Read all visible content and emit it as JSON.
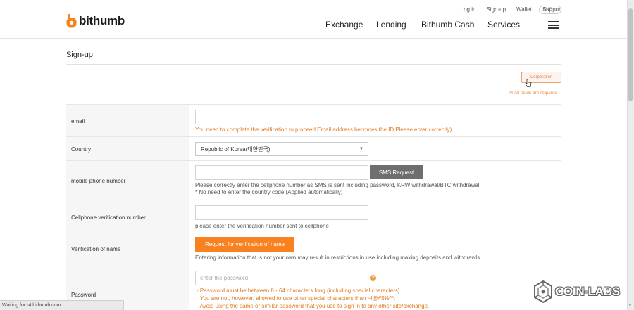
{
  "header": {
    "top_links": [
      "Log in",
      "Sign-up",
      "Wallet",
      "Support"
    ],
    "language": "ENG",
    "logo_text": "bithumb",
    "nav": [
      "Exchange",
      "Lending",
      "Bithumb Cash",
      "Services"
    ]
  },
  "page": {
    "title": "Sign-up",
    "corporation_button": "Corporation",
    "required_note": "※ All fields are required"
  },
  "form": {
    "email": {
      "label": "email",
      "message": "You need to complete the verification to proceed Email address becomes the ID Please enter correctly)"
    },
    "country": {
      "label": "Country",
      "selected": "Republic of Korea(대한민국)"
    },
    "mobile": {
      "label": "mobile phone number",
      "button": "SMS Request",
      "help1": "Please correctly enter the cellphone number as SMS is sent including password, KRW withdrawal/BTC withdrawal",
      "help2": "* No need to enter the country code.(Applied automatically)"
    },
    "verification_number": {
      "label": "Cellphone verification number",
      "help": "please enter the verification number sent to cellphone"
    },
    "name_verification": {
      "label": "Verification of name",
      "button": "Request for verification of name",
      "help": "Entering information that is not your own may result in restrictions in use including making deposits and withdrawls."
    },
    "password": {
      "label": "Password",
      "placeholder": "enter the password",
      "rule1": "- Password must be between 8 - 64 characters long (including special characters).",
      "rule2": "You are not, however, allowed to use other special characters than ~!@#$%^*.",
      "rule3": "- Avoid using the same or similar password that you use to sign in to any other site/exchange."
    }
  },
  "status_bar": "Waiting for r4.bithumb.com...",
  "watermark": "COIN-LABS",
  "colors": {
    "brand_orange": "#f7821f",
    "message_orange": "#e07a1f",
    "sms_gray": "#6e6e6e"
  }
}
